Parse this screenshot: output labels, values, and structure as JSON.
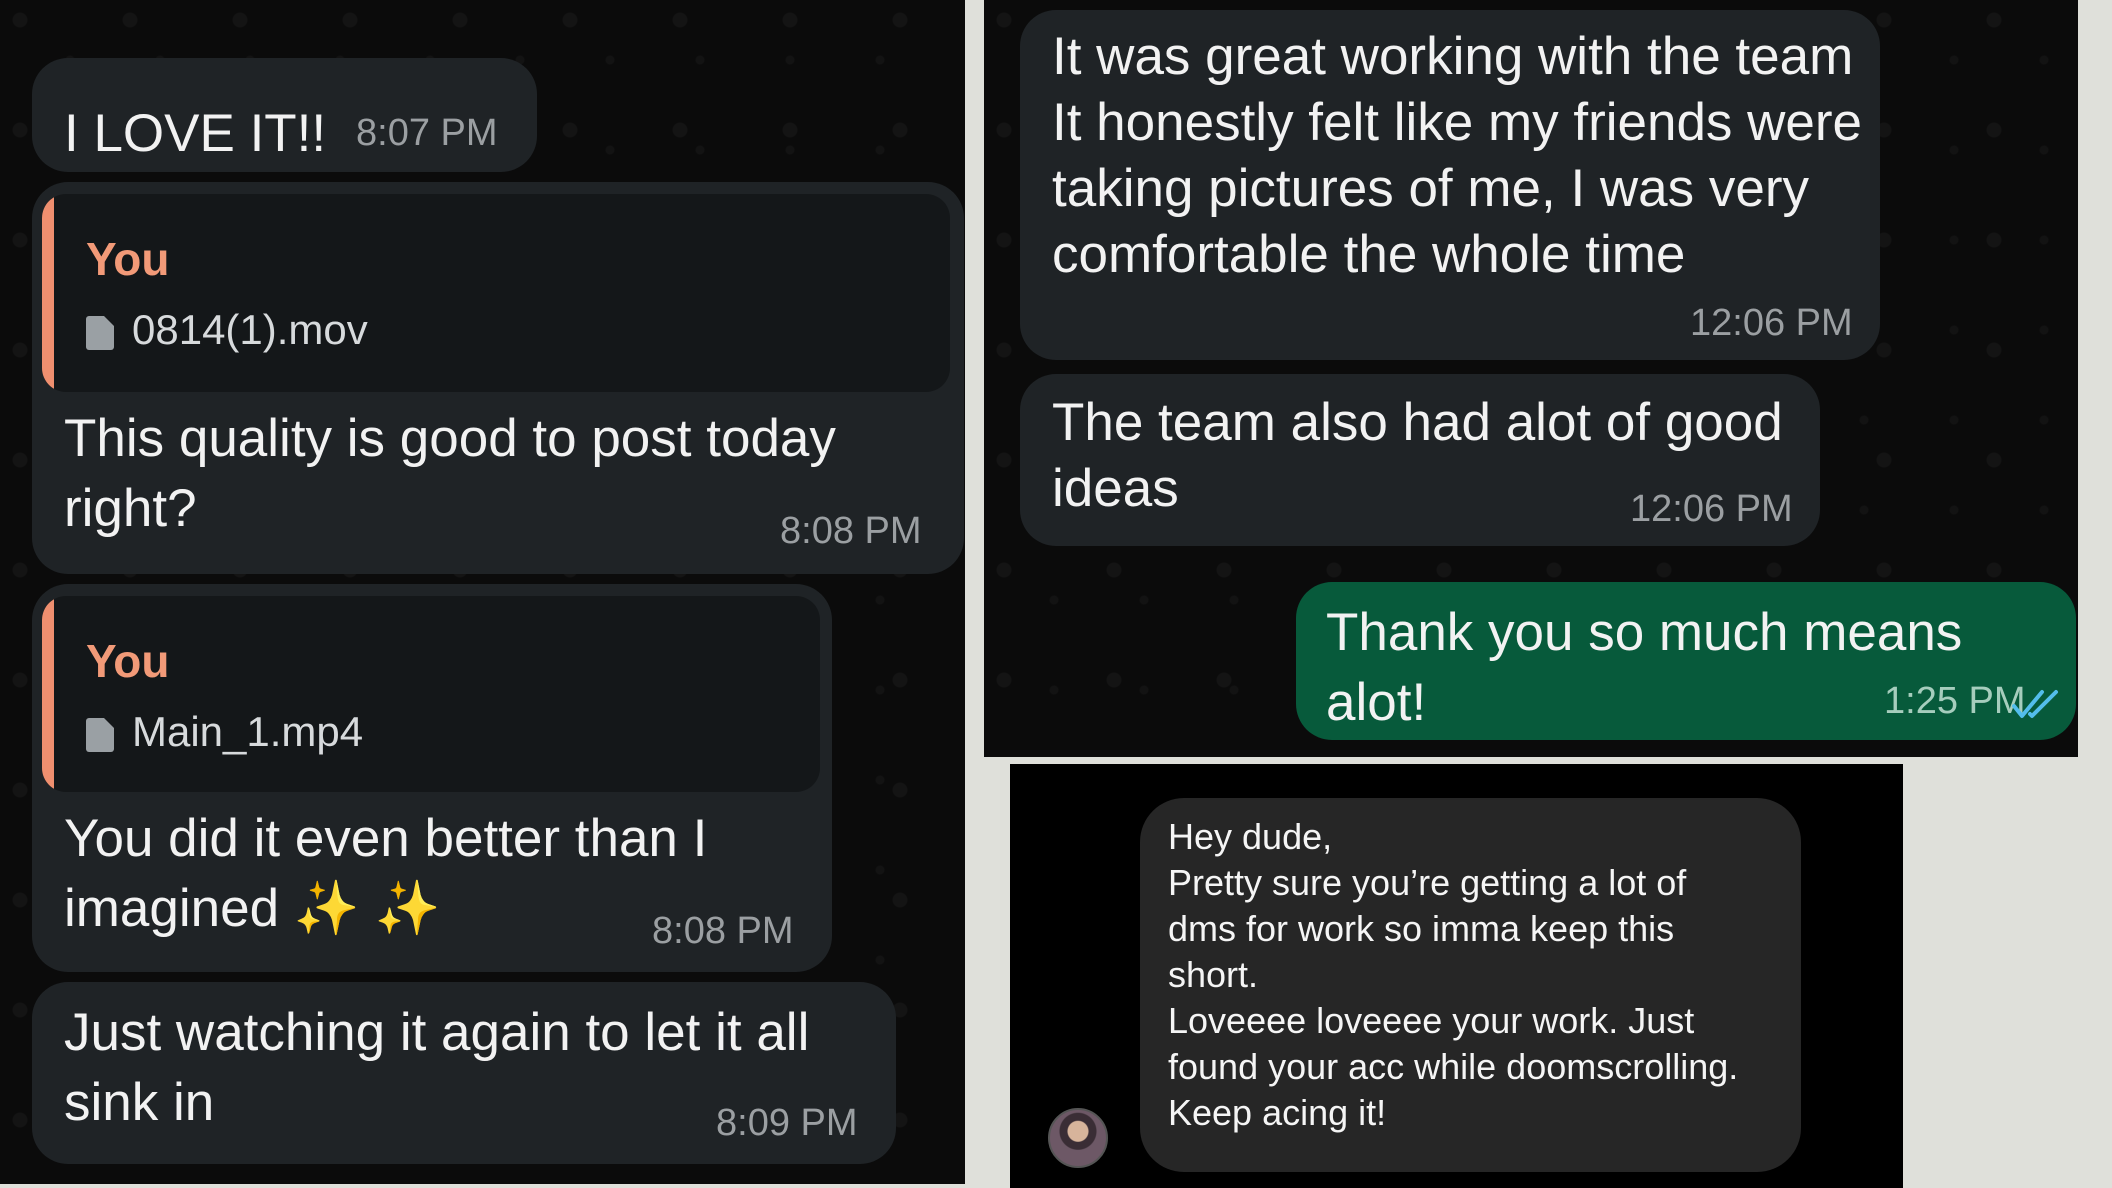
{
  "left_chat": {
    "messages": [
      {
        "text": "I LOVE IT!!",
        "time": "8:07 PM"
      },
      {
        "quote_author": "You",
        "quote_file": "0814(1).mov",
        "text": "This quality is good to post today\nright?",
        "time": "8:08 PM"
      },
      {
        "quote_author": "You",
        "quote_file": "Main_1.mp4",
        "text": "You did it even better than I\nimagined ✨ ✨",
        "time": "8:08 PM"
      },
      {
        "text": "Just watching it again to let it all\nsink in",
        "time": "8:09 PM"
      }
    ]
  },
  "right_chat": {
    "messages": [
      {
        "text": "It was great working with the team\nIt honestly felt like my friends were\ntaking pictures of me, I was very\ncomfortable the whole time",
        "time": "12:06 PM"
      },
      {
        "text": "The team also had alot of good\nideas",
        "time": "12:06 PM"
      },
      {
        "text": "Thank you so much means alot!",
        "time": "1:25 PM",
        "status_icon": "double-check-icon",
        "outgoing": true
      }
    ]
  },
  "dm": {
    "text": "Hey dude,\nPretty sure you’re getting a lot of\ndms for work so imma keep this\nshort.\nLoveeee loveeee your work. Just\nfound your acc while doomscrolling.\nKeep acing it!"
  },
  "colors": {
    "page_bg": "#dfe0da",
    "chat_bg": "#0b0b0b",
    "incoming_bubble": "#1f2326",
    "outgoing_bubble": "#075a3b",
    "quote_accent": "#ef8f6f",
    "read_ticks": "#53bdeb"
  }
}
